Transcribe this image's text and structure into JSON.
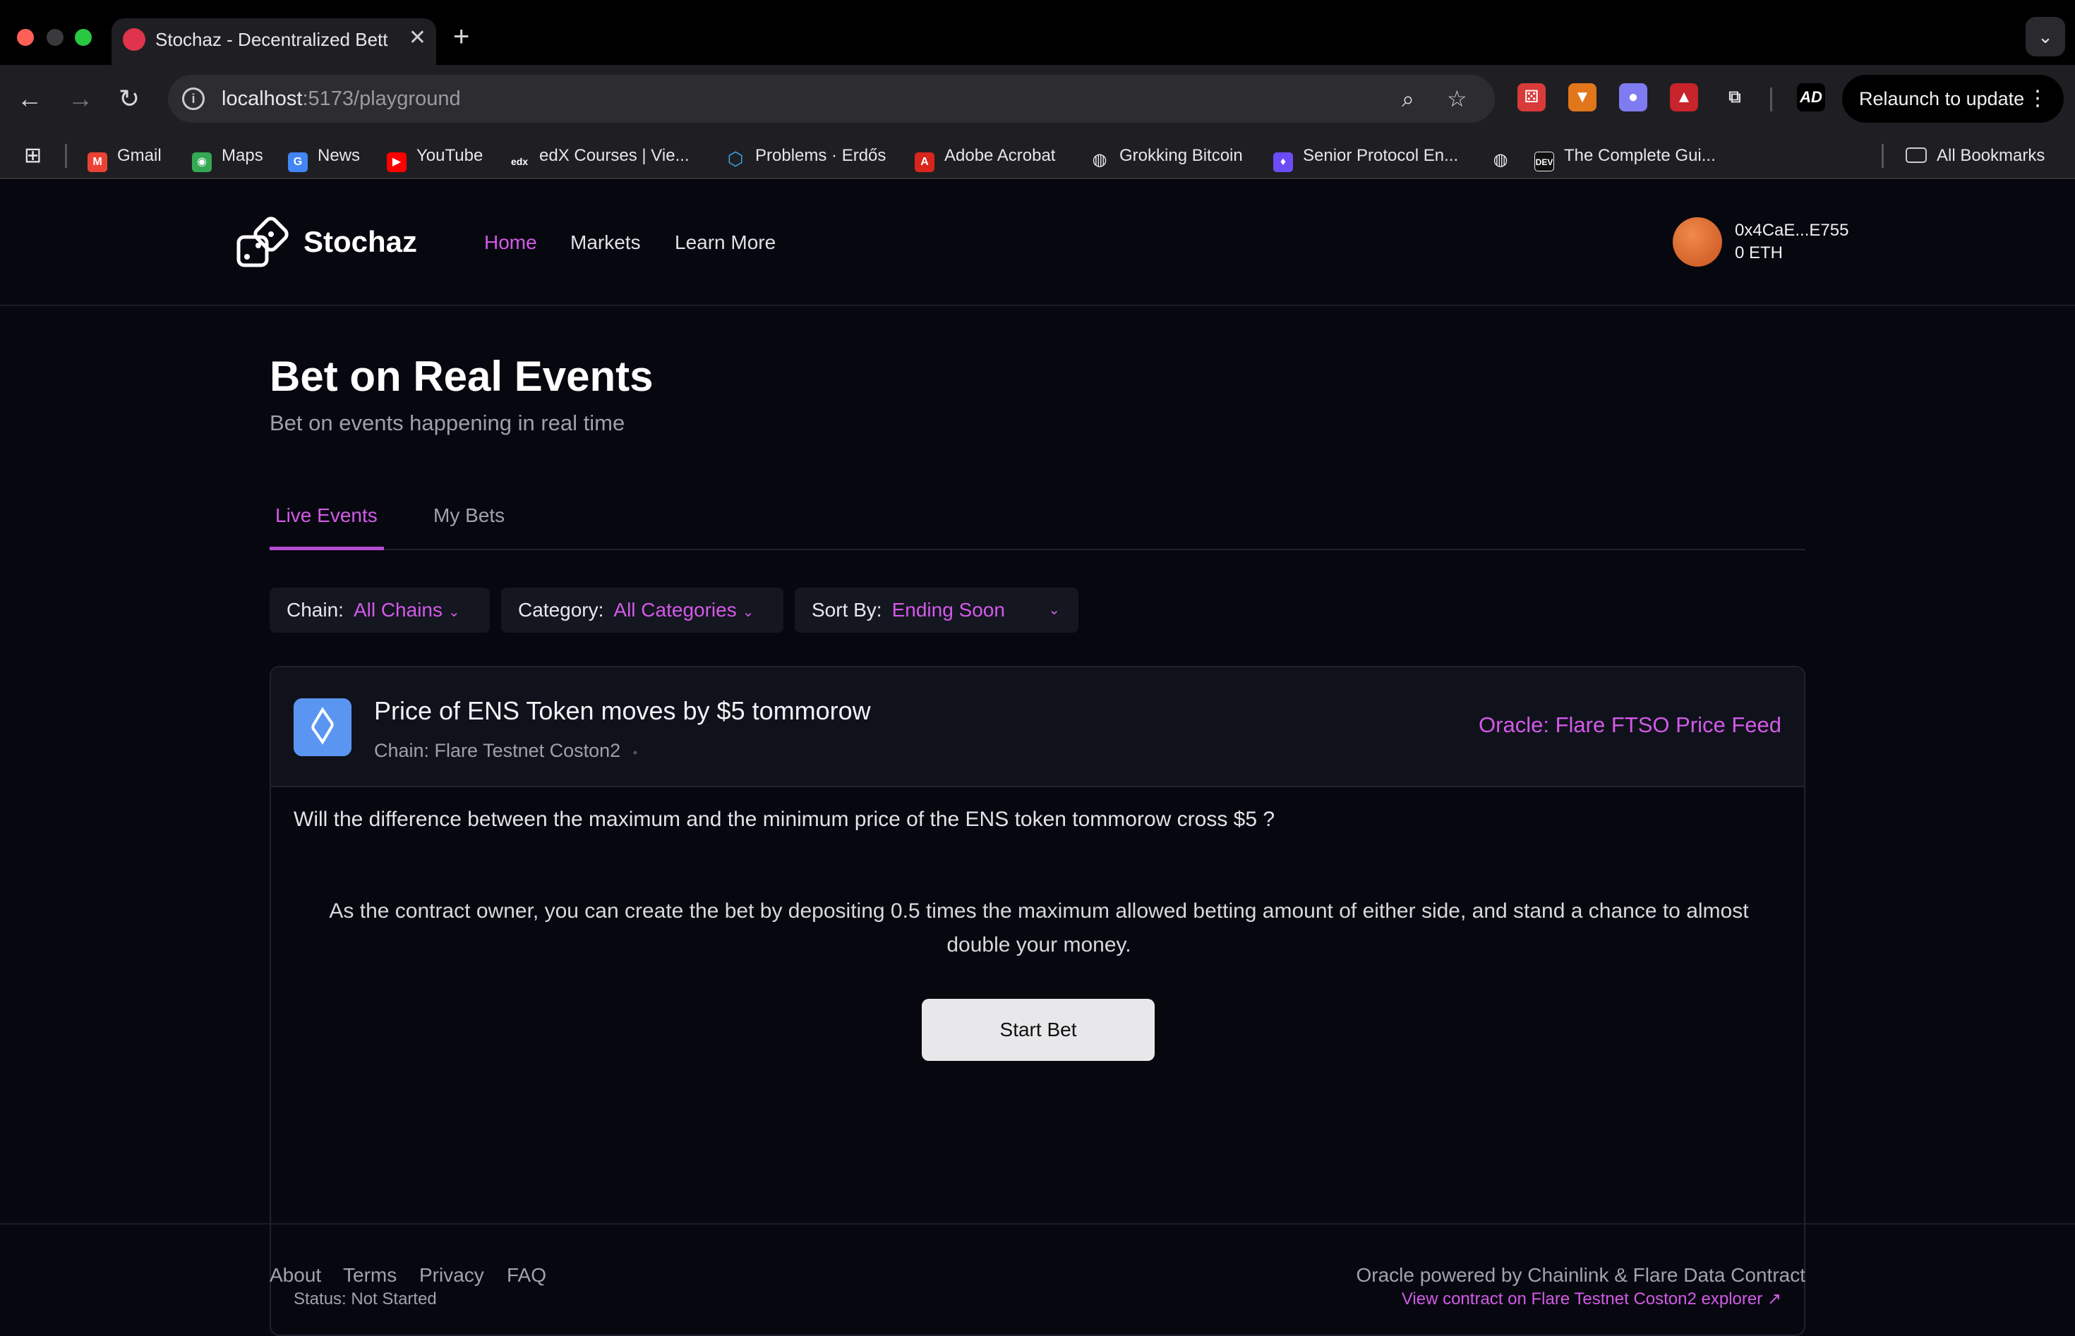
{
  "browser": {
    "tab_title": "Stochaz - Decentralized Betting",
    "new_tab_icon": "plus-icon",
    "url_host": "localhost",
    "url_path": ":5173/playground",
    "relaunch_label": "Relaunch to update",
    "bookmarks": [
      {
        "label": "Gmail",
        "color": "#ea4335"
      },
      {
        "label": "Maps",
        "color": "#34a853"
      },
      {
        "label": "News",
        "color": "#4285f4"
      },
      {
        "label": "YouTube",
        "color": "#ff0000"
      },
      {
        "label": "edX Courses | Vie...",
        "color": "#1f1f23"
      },
      {
        "label": "Problems · Erdős",
        "color": "#1f1f23"
      },
      {
        "label": "Adobe Acrobat",
        "color": "#d9251c"
      },
      {
        "label": "Grokking Bitcoin",
        "color": "#1f1f23"
      },
      {
        "label": "Senior Protocol En...",
        "color": "#6b4cf6"
      },
      {
        "label": "The Complete Gui...",
        "color": "#111111"
      }
    ],
    "all_bookmarks": "All Bookmarks"
  },
  "app": {
    "logo_text": "Stochaz",
    "nav": [
      "Home",
      "Markets",
      "Learn More"
    ],
    "account_address": "0x4CaE...E755",
    "account_balance": "0 ETH"
  },
  "page": {
    "title": "Bet on Real Events",
    "subtitle": "Bet on events happening in real time",
    "tabs": [
      "Live Events",
      "My Bets"
    ]
  },
  "filters": {
    "chain_label": "Chain:",
    "chain_value": "All Chains",
    "category_label": "Category:",
    "category_value": "All Categories",
    "sort_label": "Sort By:",
    "sort_value": "Ending Soon"
  },
  "event": {
    "title": "Price of ENS Token moves by $5 tommorow",
    "chain": "Chain: Flare Testnet Coston2",
    "chain_dot": "•",
    "oracle": "Oracle: Flare FTSO Price Feed",
    "question": "Will the difference between the maximum and the minimum price of the ENS token tommorow cross $5 ?",
    "owner_note": "As the contract owner, you can create the bet by depositing 0.5 times the maximum allowed betting amount of either side, and stand a chance to almost double your money.",
    "start_button": "Start Bet",
    "status": "Status: Not Started",
    "explorer_link": "View contract on Flare Testnet Coston2 explorer ↗"
  },
  "footer": {
    "links": [
      "About",
      "Terms",
      "Privacy",
      "FAQ"
    ],
    "powered_by": "Oracle powered by Chainlink & Flare Data Contract"
  },
  "colors": {
    "accent": "#d35ae8",
    "background": "#07080f",
    "card_header": "#10121b"
  }
}
